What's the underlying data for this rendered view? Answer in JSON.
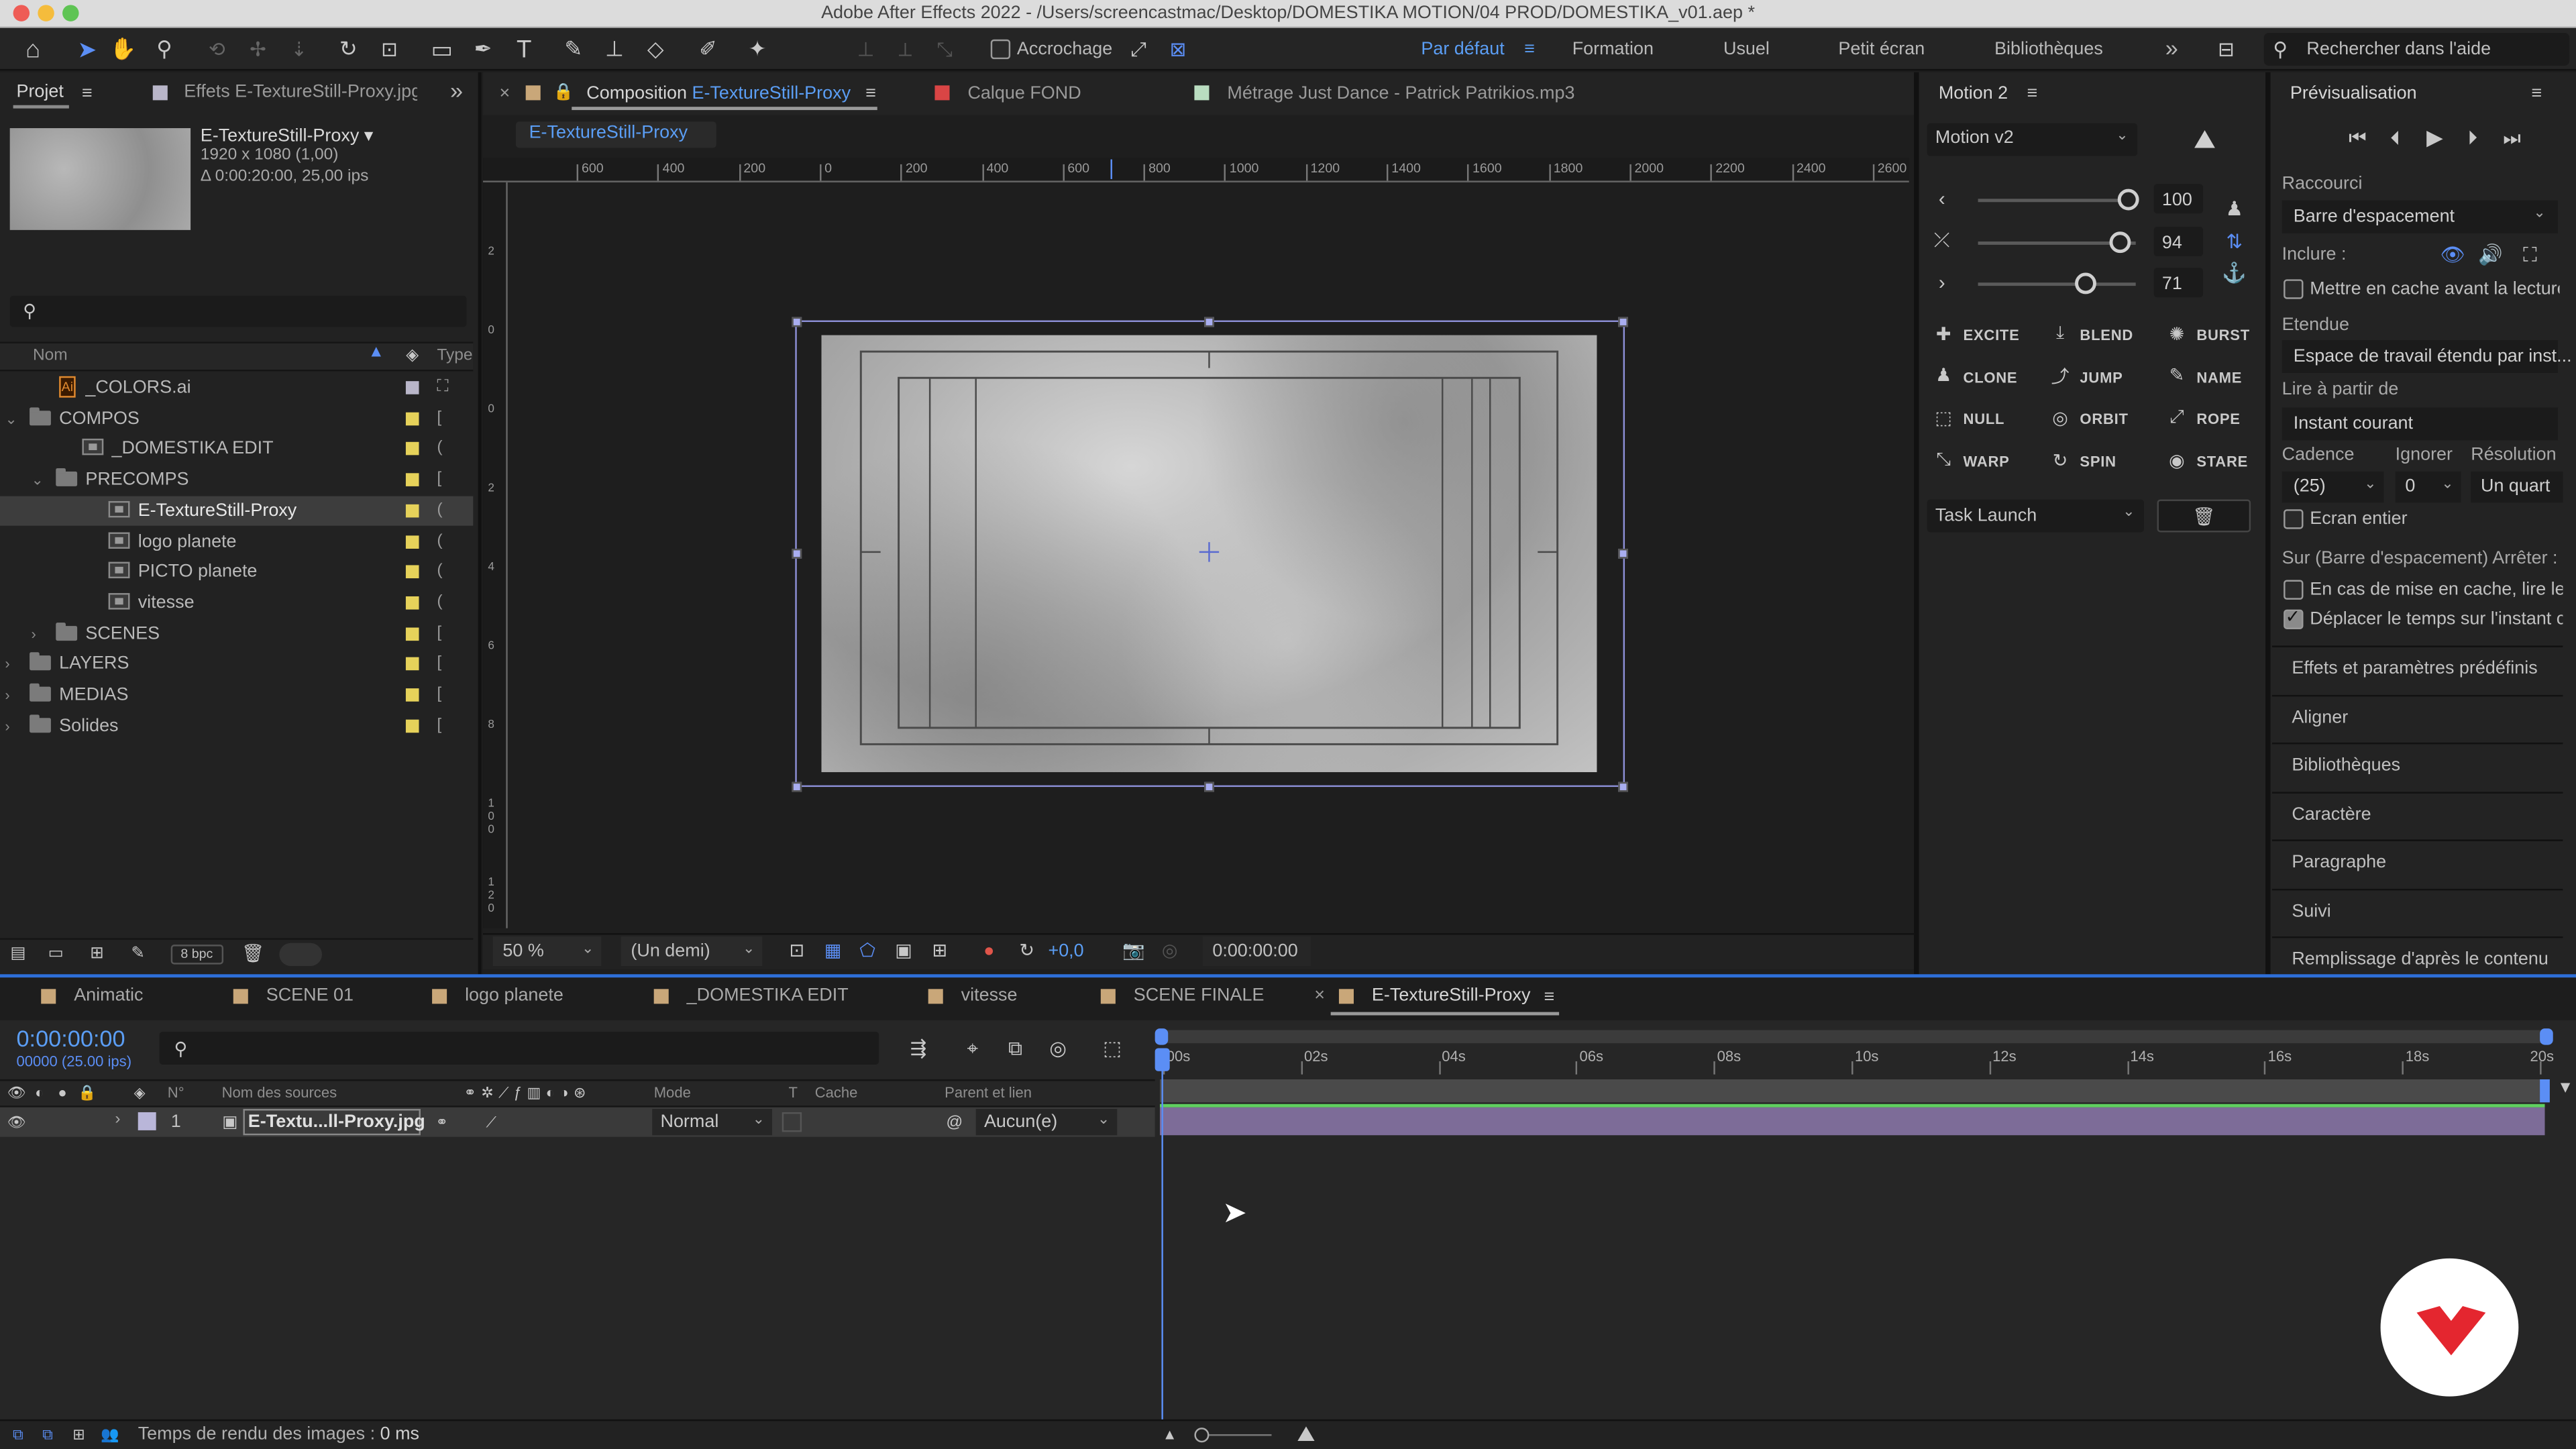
{
  "app_title": "Adobe After Effects 2022 - /Users/screencastmac/Desktop/DOMESTIKA MOTION/04 PROD/DOMESTIKA_v01.aep *",
  "toolbar": {
    "snapping_label": "Accrochage"
  },
  "workspaces": {
    "items": [
      "Par défaut",
      "Formation",
      "Usuel",
      "Petit écran",
      "Bibliothèques"
    ],
    "active": "Par défaut",
    "more": "»"
  },
  "search_help": {
    "placeholder": "Rechercher dans l'aide"
  },
  "project": {
    "tab_label": "Projet",
    "effects_tab": "Effets  E-TextureStill-Proxy.jpg",
    "selected_name": "E-TextureStill-Proxy",
    "selected_dims": "1920 x 1080 (1,00)",
    "selected_duration": "Δ 0:00:20:00, 25,00 ips",
    "search_icon": "search-icon",
    "columns": {
      "name": "Nom",
      "type": "Type"
    },
    "items": [
      {
        "label": "_COLORS.ai",
        "indent": 1,
        "kind": "ai",
        "color": "#b9b6c9",
        "type": "⛶",
        "expander": ""
      },
      {
        "label": "COMPOS",
        "indent": 0,
        "kind": "folder",
        "color": "#e6d25a",
        "type": "[",
        "expander": "⌄"
      },
      {
        "label": "_DOMESTIKA EDIT",
        "indent": 2,
        "kind": "comp",
        "color": "#e6d25a",
        "type": "(",
        "expander": ""
      },
      {
        "label": "PRECOMPS",
        "indent": 1,
        "kind": "folder",
        "color": "#e6d25a",
        "type": "[",
        "expander": "⌄"
      },
      {
        "label": "E-TextureStill-Proxy",
        "indent": 3,
        "kind": "comp",
        "color": "#e6d25a",
        "type": "(",
        "expander": "",
        "selected": true
      },
      {
        "label": "logo planete",
        "indent": 3,
        "kind": "comp",
        "color": "#e6d25a",
        "type": "(",
        "expander": ""
      },
      {
        "label": "PICTO planete",
        "indent": 3,
        "kind": "comp",
        "color": "#e6d25a",
        "type": "(",
        "expander": ""
      },
      {
        "label": "vitesse",
        "indent": 3,
        "kind": "comp",
        "color": "#e6d25a",
        "type": "(",
        "expander": ""
      },
      {
        "label": "SCENES",
        "indent": 1,
        "kind": "folder",
        "color": "#e6d25a",
        "type": "[",
        "expander": "›"
      },
      {
        "label": "LAYERS",
        "indent": 0,
        "kind": "folder",
        "color": "#e6d25a",
        "type": "[",
        "expander": "›"
      },
      {
        "label": "MEDIAS",
        "indent": 0,
        "kind": "folder",
        "color": "#e6d25a",
        "type": "[",
        "expander": "›"
      },
      {
        "label": "Solides",
        "indent": 0,
        "kind": "folder",
        "color": "#e6d25a",
        "type": "[",
        "expander": "›"
      }
    ],
    "bpc_label": "8 bpc"
  },
  "comp_tabs": {
    "composition_label": "Composition",
    "composition_name": "E-TextureStill-Proxy",
    "layer_label": "Calque",
    "layer_name": "FOND",
    "footage_label": "Métrage",
    "footage_name": "Just Dance - Patrick Patrikios.mp3",
    "breadcrumb": "E-TextureStill-Proxy"
  },
  "ruler": {
    "h_labels": [
      "600",
      "400",
      "200",
      "0",
      "200",
      "400",
      "600",
      "800",
      "1000",
      "1200",
      "1400",
      "1600",
      "1800",
      "2000",
      "2200",
      "2400",
      "2600"
    ],
    "v_labels": [
      "2",
      "0",
      "0",
      "2",
      "4",
      "6",
      "8",
      "1 0 0",
      "1 2 0"
    ]
  },
  "viewer_bar": {
    "zoom": "50 %",
    "resolution": "(Un demi)",
    "exposure": "+0,0",
    "timecode": "0:00:00:00"
  },
  "motion": {
    "title": "Motion 2",
    "preset": "Motion v2",
    "sliders": [
      {
        "icon": "‹",
        "value": "100",
        "pos": 0.92
      },
      {
        "icon": "⤫",
        "value": "94",
        "pos": 0.87
      },
      {
        "icon": "›",
        "value": "71",
        "pos": 0.66
      }
    ],
    "buttons": [
      [
        "EXCITE",
        "BLEND",
        "BURST"
      ],
      [
        "CLONE",
        "JUMP",
        "NAME"
      ],
      [
        "NULL",
        "ORBIT",
        "ROPE"
      ],
      [
        "WARP",
        "SPIN",
        "STARE"
      ]
    ],
    "task": "Task Launch"
  },
  "preview": {
    "title": "Prévisualisation",
    "shortcut_label": "Raccourci",
    "shortcut_value": "Barre d'espacement",
    "include_label": "Inclure :",
    "cache_label": "Mettre en cache avant la lecture",
    "range_label": "Etendue",
    "range_value": "Espace de travail étendu par inst...",
    "play_from_label": "Lire à partir de",
    "play_from_value": "Instant courant",
    "framerate_label": "Cadence",
    "skip_label": "Ignorer",
    "resolution_label": "Résolution",
    "framerate_value": "(25)",
    "skip_value": "0",
    "resolution_value": "Un quart",
    "fullscreen_label": "Ecran entier",
    "stop_label": "Sur (Barre d'espacement) Arrêter :",
    "opt1": "En cas de mise en cache, lire les",
    "opt2": "Déplacer le temps sur l'instant c"
  },
  "right_panels": [
    "Effets et paramètres prédéfinis",
    "Aligner",
    "Bibliothèques",
    "Caractère",
    "Paragraphe",
    "Suivi",
    "Remplissage d'après le contenu"
  ],
  "timeline_tabs": [
    {
      "label": "Animatic",
      "color": "#c9a779"
    },
    {
      "label": "SCENE 01",
      "color": "#c9a779"
    },
    {
      "label": "logo planete",
      "color": "#c9a779"
    },
    {
      "label": "_DOMESTIKA EDIT",
      "color": "#c9a779"
    },
    {
      "label": "vitesse",
      "color": "#c9a779"
    },
    {
      "label": "SCENE FINALE",
      "color": "#c9a779"
    },
    {
      "label": "E-TextureStill-Proxy",
      "color": "#c9a779",
      "active": true
    }
  ],
  "timeline": {
    "timecode": "0:00:00:00",
    "timecode_sub": "00000 (25.00 ips)",
    "columns": {
      "num": "N°",
      "source": "Nom des sources",
      "mode": "Mode",
      "t": "T",
      "mask": "Cache",
      "parent": "Parent et lien"
    },
    "ruler_labels": [
      "00s",
      "02s",
      "04s",
      "06s",
      "08s",
      "10s",
      "12s",
      "14s",
      "16s",
      "18s",
      "20s"
    ],
    "layer": {
      "num": "1",
      "name": "E-Textu...ll-Proxy.jpg",
      "mode": "Normal",
      "parent": "Aucun(e)"
    }
  },
  "status": {
    "render_label": "Temps de rendu des images :",
    "render_value": "0 ms"
  }
}
